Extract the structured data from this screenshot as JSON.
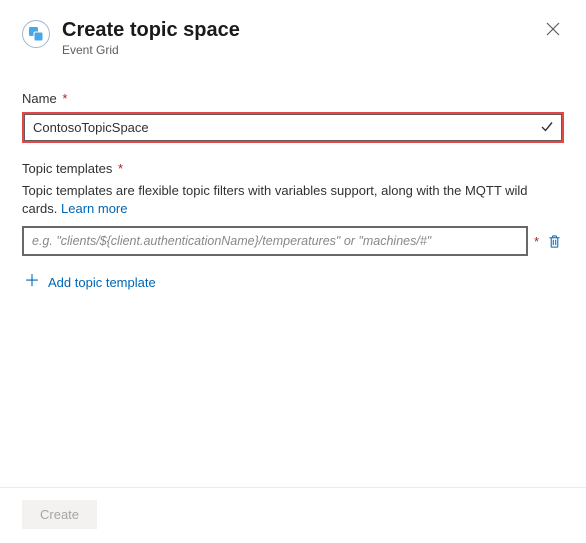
{
  "header": {
    "title": "Create topic space",
    "subtitle": "Event Grid"
  },
  "nameField": {
    "label": "Name",
    "value": "ContosoTopicSpace"
  },
  "templatesField": {
    "label": "Topic templates",
    "description": "Topic templates are flexible topic filters with variables support, along with the MQTT wild cards. ",
    "learnMore": "Learn more",
    "placeholder": "e.g. \"clients/${client.authenticationName}/temperatures\" or \"machines/#\"",
    "addLabel": "Add topic template"
  },
  "footer": {
    "createLabel": "Create"
  },
  "requiredMark": "*"
}
